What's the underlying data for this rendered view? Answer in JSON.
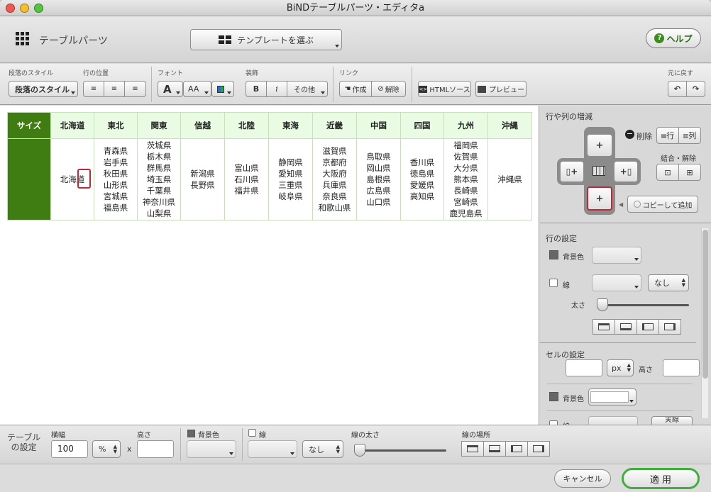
{
  "window": {
    "title": "BiNDテーブルパーツ・エディタa"
  },
  "header": {
    "title": "テーブルパーツ",
    "template_button": "テンプレートを選ぶ",
    "help_button": "ヘルプ"
  },
  "toolbar": {
    "paragraph_style_label": "段落のスタイル",
    "paragraph_style_value": "段落のスタイル",
    "row_position_label": "行の位置",
    "font_label": "フォント",
    "font_a": "A",
    "font_size": "AA",
    "decoration_label": "装飾",
    "bold": "B",
    "italic": "i",
    "other": "その他",
    "link_label": "リンク",
    "create_link": "作成",
    "remove_link": "解除",
    "html_source": "HTMLソース",
    "preview": "プレビュー",
    "undo_label": "元に戻す"
  },
  "table": {
    "headers": [
      "サイズ",
      "北海道",
      "東北",
      "関東",
      "信越",
      "北陸",
      "東海",
      "近畿",
      "中国",
      "四国",
      "九州",
      "沖縄"
    ],
    "cells": [
      "",
      "北海道",
      "青森県\n岩手県\n秋田県\n山形県\n宮城県\n福島県",
      "茨城県\n栃木県\n群馬県\n埼玉県\n千葉県\n神奈川県\n山梨県",
      "新潟県\n長野県",
      "富山県\n石川県\n福井県",
      "静岡県\n愛知県\n三重県\n岐阜県",
      "滋賀県\n京都府\n大阪府\n兵庫県\n奈良県\n和歌山県",
      "鳥取県\n岡山県\n島根県\n広島県\n山口県",
      "香川県\n徳島県\n愛媛県\n高知県",
      "福岡県\n佐賀県\n大分県\n熊本県\n長崎県\n宮崎県\n鹿児島県",
      "沖縄県"
    ]
  },
  "right_panel": {
    "rowcol_title": "行や列の増減",
    "delete_label": "削除",
    "row_btn": "行",
    "col_btn": "列",
    "merge_label": "結合・解除",
    "copy_add": "コピーして追加",
    "row_settings_title": "行の設定",
    "bg_color": "背景色",
    "line": "線",
    "none": "なし",
    "thickness": "太さ",
    "cell_settings_title": "セルの設定",
    "px": "px",
    "height": "高さ",
    "cell_bg": "背景色",
    "cell_line": "線",
    "solid": "実線"
  },
  "bottom": {
    "table_settings": "テーブル\nの設定",
    "width_label": "横幅",
    "width_value": "100",
    "unit": "%",
    "x": "x",
    "height_label": "高さ",
    "bg_label": "背景色",
    "line_label": "線",
    "none": "なし",
    "line_width": "線の太さ",
    "line_place": "線の場所"
  },
  "footer": {
    "cancel": "キャンセル",
    "apply": "適 用"
  },
  "colors": {
    "accent_green": "#3f7c12",
    "header_cell_bg": "#e9fbe3",
    "apply_border": "#3fae3f"
  }
}
